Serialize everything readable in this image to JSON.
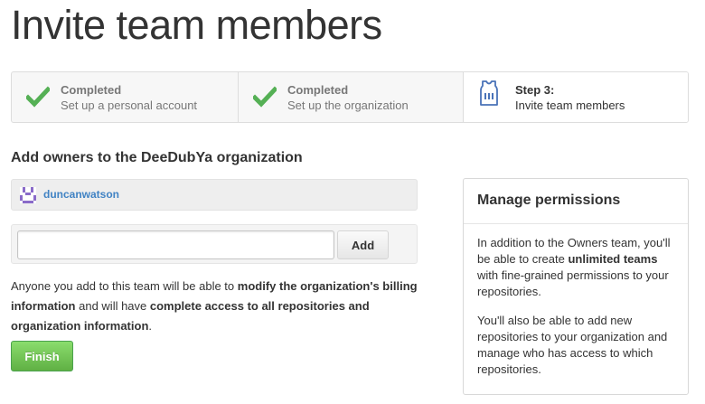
{
  "page": {
    "title": "Invite team members"
  },
  "steps": [
    {
      "title": "Completed",
      "desc": "Set up a personal account",
      "icon": "check-icon"
    },
    {
      "title": "Completed",
      "desc": "Set up the organization",
      "icon": "check-icon"
    },
    {
      "title": "Step 3:",
      "desc": "Invite team members",
      "icon": "jersey-icon"
    }
  ],
  "owners": {
    "heading": "Add owners to the DeeDubYa organization",
    "members": [
      {
        "username": "duncanwatson",
        "avatar": "identicon-avatar"
      }
    ],
    "input_value": "",
    "add_label": "Add"
  },
  "notice": {
    "t1": "Anyone you add to this team will be able to ",
    "b1": "modify the organization's billing information",
    "t2": " and will have ",
    "b2": "complete access to all repositories and organization information",
    "t3": "."
  },
  "finish_label": "Finish",
  "permissions": {
    "title": "Manage permissions",
    "p1_a": "In addition to the Owners team, you'll be able to create ",
    "p1_b": "unlimited teams",
    "p1_c": " with fine-grained permissions to your repositories.",
    "p2": "You'll also be able to add new repositories to your organization and manage who has access to which repositories."
  },
  "colors": {
    "check_green": "#55b055",
    "link_blue": "#4183c4",
    "finish_green": "#60b044",
    "jersey_blue": "#4a73b8",
    "avatar_purple": "#8a6bc9"
  }
}
